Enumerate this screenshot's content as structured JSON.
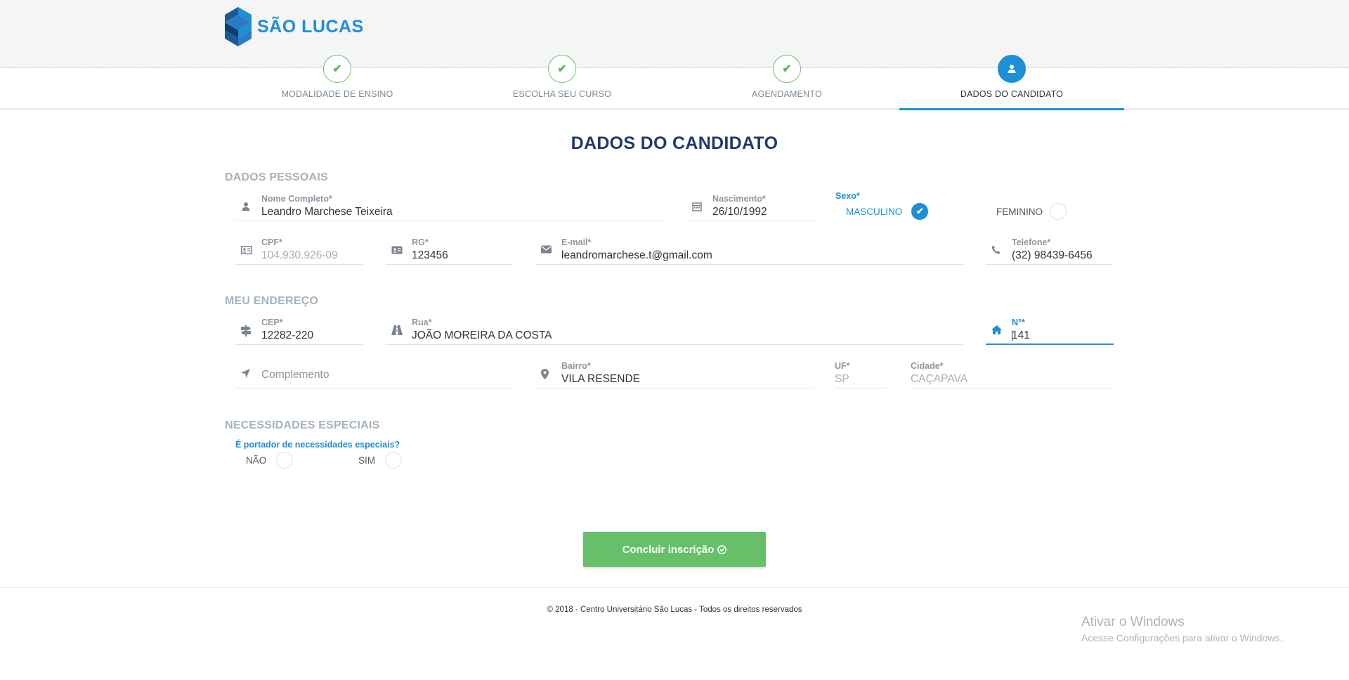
{
  "brand": {
    "name": "SÃO LUCAS",
    "color": "#1d8fd6"
  },
  "steps": [
    {
      "label": "MODALIDADE DE ENSINO",
      "state": "done",
      "icon": "check-icon"
    },
    {
      "label": "ESCOLHA SEU CURSO",
      "state": "done",
      "icon": "check-icon"
    },
    {
      "label": "AGENDAMENTO",
      "state": "done",
      "icon": "check-icon"
    },
    {
      "label": "DADOS DO CANDIDATO",
      "state": "active",
      "icon": "user-icon"
    }
  ],
  "page_title": "DADOS DO CANDIDATO",
  "sections": {
    "personal": "DADOS PESSOAIS",
    "address": "MEU ENDEREÇO",
    "special": "NECESSIDADES ESPECIAIS"
  },
  "personal": {
    "nome": {
      "label": "Nome Completo*",
      "value": "Leandro Marchese Teixeira",
      "icon": "user-icon"
    },
    "nascimento": {
      "label": "Nascimento*",
      "value": "26/10/1992",
      "icon": "calendar-icon"
    },
    "sexo": {
      "label": "Sexo*",
      "options": [
        {
          "label": "MASCULINO",
          "checked": true
        },
        {
          "label": "FEMININO",
          "checked": false
        }
      ]
    },
    "cpf": {
      "label": "CPF*",
      "value": "104.930.926-09",
      "icon": "id-card-icon"
    },
    "rg": {
      "label": "RG*",
      "value": "123456",
      "icon": "id-card-icon"
    },
    "email": {
      "label": "E-mail*",
      "value": "leandromarchese.t@gmail.com",
      "icon": "envelope-icon"
    },
    "telefone": {
      "label": "Telefone*",
      "value": "(32) 98439-6456",
      "icon": "phone-icon"
    }
  },
  "address": {
    "cep": {
      "label": "CEP*",
      "value": "12282-220",
      "icon": "signpost-icon"
    },
    "rua": {
      "label": "Rua*",
      "value": "JOÃO MOREIRA DA COSTA",
      "icon": "road-icon"
    },
    "numero": {
      "label": "N°*",
      "value": "141",
      "icon": "home-icon"
    },
    "complemento": {
      "placeholder": "Complemento",
      "icon": "location-arrow-icon"
    },
    "bairro": {
      "label": "Bairro*",
      "value": "VILA RESENDE",
      "icon": "map-marker-icon"
    },
    "uf": {
      "label": "UF*",
      "value": "SP"
    },
    "cidade": {
      "label": "Cidade*",
      "value": "CAÇAPAVA"
    }
  },
  "special": {
    "question": "É portador de necessidades especiais?",
    "options": [
      {
        "label": "NÃO",
        "checked": false
      },
      {
        "label": "SIM",
        "checked": false
      }
    ]
  },
  "submit": {
    "label": "Concluir inscrição",
    "icon": "check-circle-icon",
    "color": "#67bf6a"
  },
  "footer": "© 2018 - Centro Universitário São Lucas - Todos os direitos reservados",
  "windows_watermark": {
    "title": "Ativar o Windows",
    "subtitle": "Acesse Configurações para ativar o Windows."
  }
}
